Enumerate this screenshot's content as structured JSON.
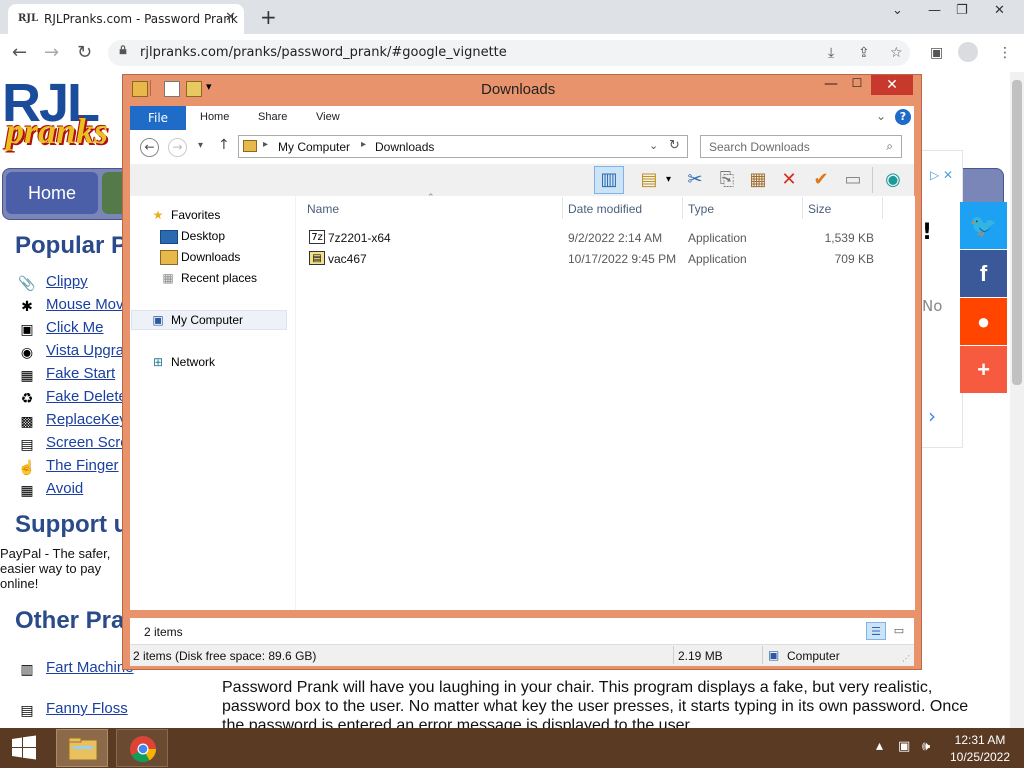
{
  "browser": {
    "tab_title": "RJLPranks.com - Password Prank",
    "tab_favicon_text": "RJL",
    "tab_close": "✕",
    "new_tab": "+",
    "url": "rjlpranks.com/pranks/password_prank/#google_vignette",
    "icons": [
      "back-icon",
      "forward-icon",
      "reload-icon",
      "lock-icon",
      "download-blocked-icon",
      "share-icon",
      "star-icon",
      "sidebar-icon",
      "profile-icon",
      "menu-icon"
    ]
  },
  "webpage": {
    "logo_text_top": "RJL",
    "logo_text_bottom": "pranks",
    "nav": {
      "home": "Home"
    },
    "popular_heading": "Popular Pranks",
    "popular_links": [
      {
        "label": "Clippy",
        "icon": "📎"
      },
      {
        "label": "Mouse Move",
        "icon": "✱"
      },
      {
        "label": "Click Me",
        "icon": "▣"
      },
      {
        "label": "Vista Upgrade",
        "icon": "◉"
      },
      {
        "label": "Fake Start",
        "icon": "▦"
      },
      {
        "label": "Fake Delete",
        "icon": "♻"
      },
      {
        "label": "ReplaceKeys",
        "icon": "▩"
      },
      {
        "label": "Screen Scroll",
        "icon": "▤"
      },
      {
        "label": "The Finger",
        "icon": "☝"
      },
      {
        "label": "Avoid",
        "icon": "▦"
      }
    ],
    "support_heading": "Support us",
    "paypal_text": "PayPal - The safer, easier way to pay online!",
    "other_heading": "Other Pranks",
    "other_links": [
      {
        "label": "Fart Machine",
        "icon": "▥"
      },
      {
        "label": "Fanny Floss",
        "icon": "▤"
      }
    ],
    "article": "Password Prank will have you laughing in your chair. This program displays a fake, but very realistic, password box to the user. No matter what key the user presses, it starts typing in its own password. Once the password is entered an error message is displayed to the user.",
    "ad_exclaim": "!",
    "ad_no": "No",
    "ad_arrow": "›",
    "ad_choice": "▷ ✕",
    "share": [
      {
        "name": "twitter",
        "label": "🐦",
        "color": "#1da1f2"
      },
      {
        "name": "facebook",
        "label": "f",
        "color": "#3b5998"
      },
      {
        "name": "reddit",
        "label": "●",
        "color": "#ff4500"
      },
      {
        "name": "more",
        "label": "+",
        "color": "#f65a3f"
      }
    ]
  },
  "explorer": {
    "title": "Downloads",
    "window_buttons": {
      "minimize": "—",
      "maximize": "☐",
      "close": "✕"
    },
    "ribbon_tabs": [
      "File",
      "Home",
      "Share",
      "View"
    ],
    "help": "?",
    "address_crumbs": [
      "My Computer",
      "Downloads"
    ],
    "search_placeholder": "Search Downloads",
    "nav": {
      "favorites": "Favorites",
      "desktop": "Desktop",
      "downloads": "Downloads",
      "recent": "Recent places",
      "my_computer": "My Computer",
      "network": "Network"
    },
    "columns": [
      "Name",
      "Date modified",
      "Type",
      "Size"
    ],
    "files": [
      {
        "name": "7z2201-x64",
        "date": "9/2/2022 2:14 AM",
        "type": "Application",
        "size": "1,539 KB",
        "icon": "7z"
      },
      {
        "name": "vac467",
        "date": "10/17/2022 9:45 PM",
        "type": "Application",
        "size": "709 KB",
        "icon": "▤"
      }
    ],
    "item_count": "2 items",
    "status": {
      "items_disk": "2 items (Disk free space: 89.6 GB)",
      "size": "2.19 MB",
      "location": "Computer"
    }
  },
  "taskbar": {
    "time": "12:31 AM",
    "date": "10/25/2022"
  }
}
